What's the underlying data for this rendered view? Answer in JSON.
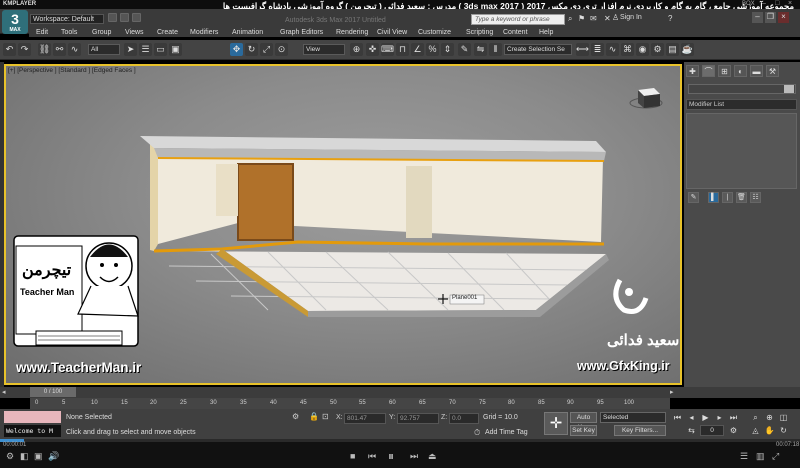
{
  "kmplayer": {
    "logo": "KMPLAYER",
    "box_label": "BOX",
    "time_start": "00:00:01",
    "time_end": "00:07:18"
  },
  "overlay_title": "مجموعه آموزشی جامع ، گام به گام و کاربردی نرم افزار تری دی مکس 2017  ( 3ds max 2017 )  مدرس : سعید فدائی ( تیچرمن ) گروه آموزشی پادشاه گرافیست ها",
  "app": {
    "button_label": "3",
    "button_sublabel": "MAX",
    "workspace": "Workspace: Default",
    "title": "Autodesk 3ds Max 2017    Untitled",
    "search_placeholder": "Type a keyword or phrase",
    "sign_in": "Sign In"
  },
  "menus": [
    "Edit",
    "Tools",
    "Group",
    "Views",
    "Create",
    "Modifiers",
    "Animation",
    "Graph Editors",
    "Rendering",
    "Civil View",
    "Customize",
    "Scripting",
    "Content",
    "Help"
  ],
  "toolbar": {
    "filter": "All",
    "refcoord": "View",
    "selection_set": "Create Selection Se"
  },
  "viewport": {
    "label": "[+] [Perspective ] [Standard ] [Edged Faces ]",
    "tooltip": "Plane001"
  },
  "command_panel": {
    "modifier_list": "Modifier List"
  },
  "timeline": {
    "frame_counter": "0 / 100",
    "ticks": [
      "0",
      "5",
      "10",
      "15",
      "20",
      "25",
      "30",
      "35",
      "40",
      "45",
      "50",
      "55",
      "60",
      "65",
      "70",
      "75",
      "80",
      "85",
      "90",
      "95",
      "100"
    ]
  },
  "status": {
    "listener": "Welcome to M",
    "selection": "None Selected",
    "prompt": "Click and drag to select and move objects",
    "x_label": "X:",
    "x_value": "801.47",
    "y_label": "Y:",
    "y_value": "92.757",
    "z_label": "Z:",
    "z_value": "0.0",
    "grid": "Grid = 10.0",
    "add_time_tag": "Add Time Tag",
    "auto_key": "Auto Key",
    "set_key": "Set Key",
    "selected": "Selected",
    "key_filters": "Key Filters...",
    "current_frame": "0"
  },
  "watermarks": {
    "teacherman_url": "www.TeacherMan.ir",
    "teacherman_fa": "تیچرمن",
    "teacherman_en": "Teacher Man",
    "gfxking_url": "www.GfxKing.ir",
    "gfxking_fa": "سعید فدائی"
  }
}
